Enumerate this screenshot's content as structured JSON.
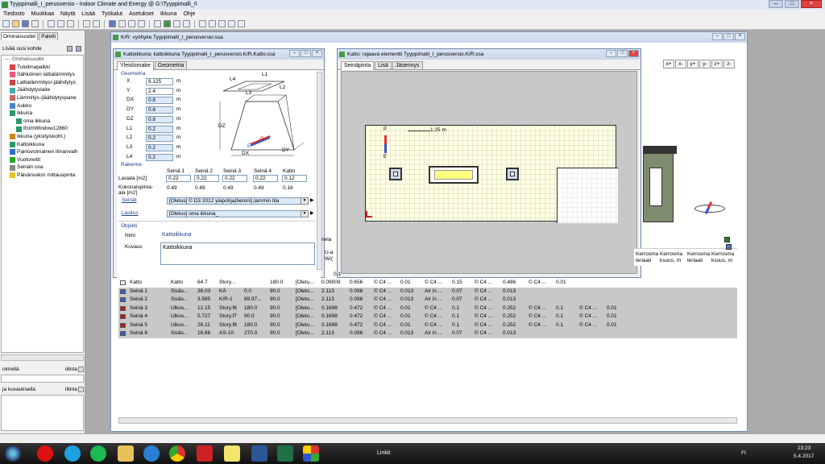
{
  "app": {
    "title": "Tyyppimalli_I_perusversio - Indoor Climate and Energy @ G:\\Tyyppimalli_I\\"
  },
  "menu": [
    "Tiedosto",
    "Muokkaa",
    "Näytä",
    "Lisää",
    "Työkalut",
    "Asetukset",
    "Ikkuna",
    "Ohje"
  ],
  "left": {
    "tabs": [
      "Ominaisuudet",
      "Paletti"
    ],
    "add_label": "Lisää uusi kohde",
    "tree_header": "Ominaisuudet",
    "items": [
      "Tuloilmapalkki",
      "Sähköinen lattialämmitys",
      "Lattialämmitys/-jäähdytys",
      "Jäähdytyslaite",
      "Lämmitys-/jäähdytyspane",
      "Aukko",
      "Ikkuna",
      "oma ikkuna",
      "IfcimWindow12860",
      "Ikkuna (yksityiskoht.)",
      "Kattoikkuna",
      "Painovoimainen ilmanvaih",
      "Vuotoreitti",
      "Seinän osa",
      "Päivänvalon mittauspinta"
    ],
    "bottom1": "nimellä",
    "bottom1b": "iilinta",
    "bottom2": "ja kuvauksella",
    "bottom2b": "iilinta"
  },
  "main_window": {
    "title": "K/R: vyöhyke Tyyppimalli_I_perusversio:ssa"
  },
  "prop": {
    "title": "Kattoikkuna: kattoikkuna Tyyppimalli_I_perusversio.K/R.Katto:ssa",
    "tabs": [
      "Yleislomake",
      "Geometria"
    ],
    "geom_label": "Geometria",
    "fields": [
      {
        "n": "X",
        "v": "8.125",
        "u": "m"
      },
      {
        "n": "Y",
        "v": "2.4",
        "u": "m"
      },
      {
        "n": "DX",
        "v": "0.8",
        "u": "m"
      },
      {
        "n": "DY",
        "v": "0.8",
        "u": "m"
      },
      {
        "n": "DZ",
        "v": "0.8",
        "u": "m"
      },
      {
        "n": "L1",
        "v": "0.2",
        "u": "m"
      },
      {
        "n": "L2",
        "v": "0.2",
        "u": "m"
      },
      {
        "n": "L3",
        "v": "0.2",
        "u": "m"
      },
      {
        "n": "L4",
        "v": "0.2",
        "u": "m"
      }
    ],
    "diagram_labels": {
      "l1": "L1",
      "l2": "L2",
      "l3": "L3",
      "l4": "L4",
      "dz": "DZ",
      "dx": "DX",
      "dy": "DY",
      "p": "P",
      "e": "E"
    },
    "rakenne_label": "Rakenne",
    "col_heads": [
      "Seinä 1",
      "Seinä 2",
      "Seinä 3",
      "Seinä 4",
      "Katto"
    ],
    "lasiala_label": "Lasiala [m2]",
    "lasiala": [
      "0.22",
      "0.22",
      "0.22",
      "0.22",
      "0.12"
    ],
    "kok_label": "Kokonaispinta-ala [m2]",
    "kok": [
      "0.49",
      "0.49",
      "0.49",
      "0.49",
      "0.16"
    ],
    "seinat_label": "Seinät",
    "seinat_value": "[Oletus] © D3 2012 ylapohja(betoni),lammin tila",
    "lasitus_label": "Lasitus",
    "lasitus_value": "[Oletus] oma ikkuna_",
    "objekti_label": "Objekti",
    "nimi_label": "Nimi",
    "nimi_value": "Kattoikkuna",
    "kuvaus_label": "Kuvaus",
    "kuvaus_value": "Kattoikkuna"
  },
  "elem": {
    "title": "Katto: rajaava elementti Tyyppimalli_I_perusversio.K/R:ssa",
    "tabs": [
      "Seinäpinta",
      "Lisä",
      "Jäsennys"
    ],
    "scale": "1.25 m",
    "p": "P",
    "e": "E"
  },
  "axis_buttons": [
    "x+",
    "x-",
    "y+",
    "y-",
    "z+",
    "z-"
  ],
  "table": {
    "hdr_a": "nela",
    "hdr_b": "U-a W/(",
    "right_headers": [
      "Kerrosma teriaali",
      "Kerrosma ksuus, m",
      "Kerrosma teriaali",
      "Kerrosma ksuus, m"
    ],
    "partial_rows": [
      [
        "",
        "",
        "",
        "",
        "",
        "",
        "",
        "",
        "",
        "",
        "0.1",
        "",
        "",
        "",
        "",
        "",
        "",
        "",
        "",
        "",
        "",
        ""
      ]
    ],
    "rows": [
      [
        "Katto",
        "Katto",
        "64.7",
        "Story...",
        "",
        "180.0",
        "[Oletu...",
        "0.09009",
        "0.656",
        "© C4 ...",
        "0.01",
        "© C4 ...",
        "0.15",
        "© C4 ...",
        "0.486",
        "© C4 ...",
        "0.01",
        "",
        "",
        "",
        "",
        ""
      ],
      [
        "Seinä 1",
        "Sisäs...",
        "36.03",
        "KÄ",
        "0.0",
        "90.0",
        "[Oletu...",
        "2.113",
        "0.096",
        "© C4 ...",
        "0.013",
        "Air in ...",
        "0.07",
        "© C4 ...",
        "0.013",
        "",
        "",
        "",
        "",
        "",
        "",
        ""
      ],
      [
        "Seinä 2",
        "Sisäs...",
        "3.585",
        "K/R-1",
        "89.97...",
        "90.0",
        "[Oletu...",
        "2.113",
        "0.096",
        "© C4 ...",
        "0.013",
        "Air in ...",
        "0.07",
        "© C4 ...",
        "0.013",
        "",
        "",
        "",
        "",
        "",
        "",
        ""
      ],
      [
        "Seinä 3",
        "Ulkos...",
        "12.15",
        "Story.f6",
        "180.0",
        "90.0",
        "[Oletu...",
        "0.1698",
        "0.472",
        "© C4 ...",
        "0.01",
        "© C4 ...",
        "0.1",
        "© C4 ...",
        "0.252",
        "© C4 ...",
        "0.1",
        "© C4 ...",
        "0.01",
        "",
        "",
        ""
      ],
      [
        "Seinä 4",
        "Ulkos...",
        "5.727",
        "Story.f7",
        "90.0",
        "90.0",
        "[Oletu...",
        "0.1698",
        "0.472",
        "© C4 ...",
        "0.01",
        "© C4 ...",
        "0.1",
        "© C4 ...",
        "0.252",
        "© C4 ...",
        "0.1",
        "© C4 ...",
        "0.01",
        "",
        "",
        ""
      ],
      [
        "Seinä 5",
        "Ulkos...",
        "26.11",
        "Story.f8",
        "180.0",
        "90.0",
        "[Oletu...",
        "0.1698",
        "0.472",
        "© C4 ...",
        "0.01",
        "© C4 ...",
        "0.1",
        "© C4 ...",
        "0.252",
        "© C4 ...",
        "0.1",
        "© C4 ...",
        "0.01",
        "",
        "",
        ""
      ],
      [
        "Seinä 6",
        "Sisäs...",
        "16.66",
        "AS-10",
        "270.0",
        "90.0",
        "[Oletu...",
        "2.113",
        "0.096",
        "© C4 ...",
        "0.013",
        "Air in ...",
        "0.07",
        "© C4 ...",
        "0.013",
        "",
        "",
        "",
        "",
        "",
        "",
        ""
      ]
    ],
    "row_colors": [
      "#ffffff",
      "#3060c0",
      "#3060c0",
      "#b02020",
      "#b02020",
      "#b02020",
      "#3060c0"
    ]
  },
  "taskbar": {
    "linkit": "Linkit",
    "lang": "FI",
    "time": "23:23",
    "date": "5.4.2017"
  },
  "colors": {
    "title_bg": "#dfe8f3",
    "selected": "#ffff80",
    "roof_bg": "#ffffe6"
  }
}
